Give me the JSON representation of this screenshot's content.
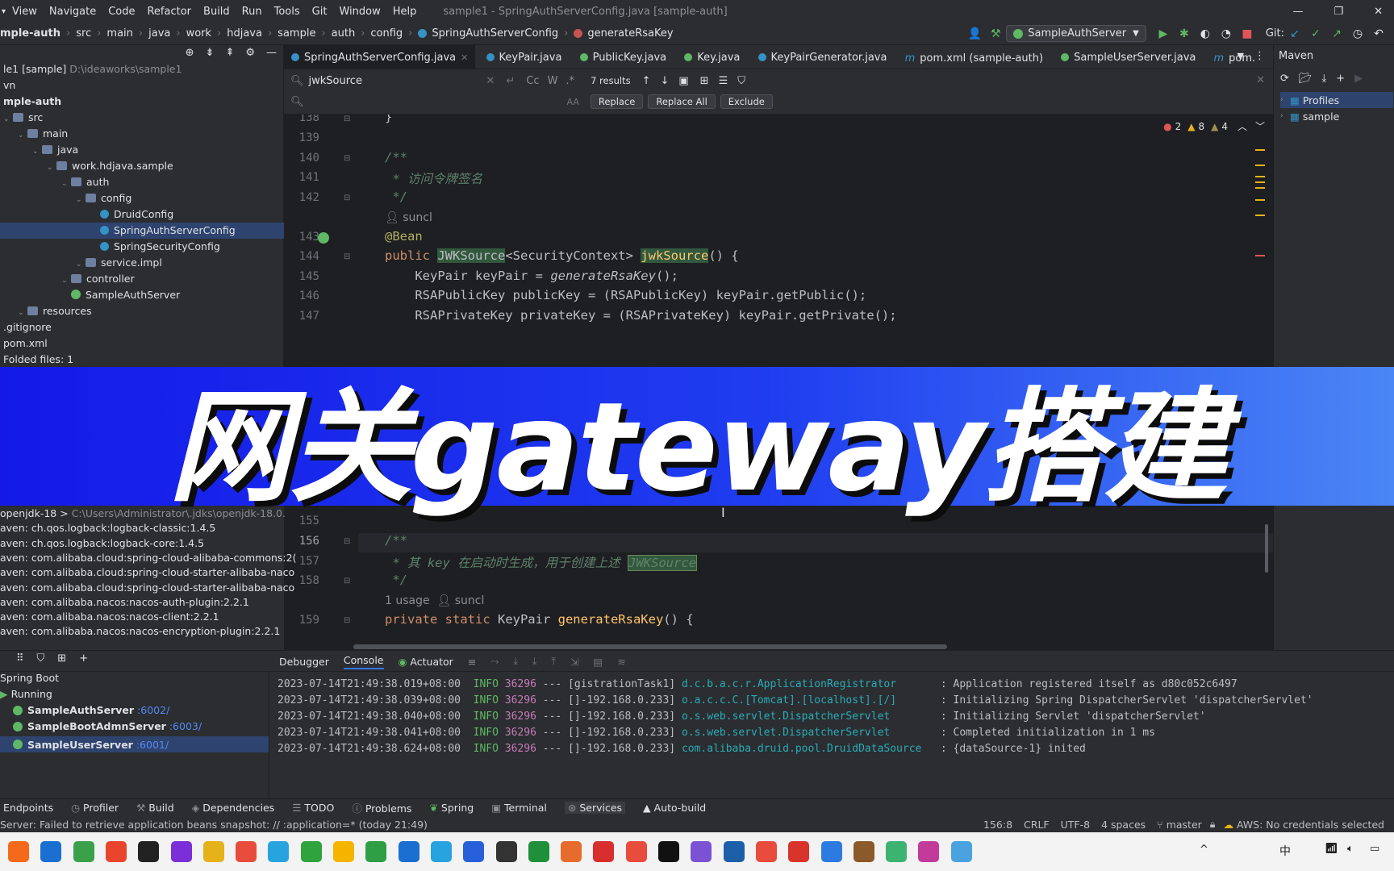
{
  "menu": {
    "items": [
      "View",
      "Navigate",
      "Code",
      "Refactor",
      "Build",
      "Run",
      "Tools",
      "Git",
      "Window",
      "Help"
    ],
    "window_title": "sample1 - SpringAuthServerConfig.java [sample-auth]"
  },
  "breadcrumb": [
    "mple-auth",
    "src",
    "main",
    "java",
    "work",
    "hdjava",
    "sample",
    "auth",
    "config",
    "SpringAuthServerConfig",
    "generateRsaKey"
  ],
  "toolbar": {
    "run_config": "SampleAuthServer",
    "git_label": "Git:"
  },
  "project_tree": [
    {
      "label": "le1 [sample]",
      "extra": "D:\\ideaworks\\sample1",
      "indent": 0,
      "icon": "module"
    },
    {
      "label": "vn",
      "indent": 0,
      "icon": "none"
    },
    {
      "label": "mple-auth",
      "indent": 0,
      "icon": "none",
      "bold": true
    },
    {
      "label": "src",
      "indent": 0,
      "icon": "folder"
    },
    {
      "label": "main",
      "indent": 1,
      "icon": "folder"
    },
    {
      "label": "java",
      "indent": 2,
      "icon": "folder"
    },
    {
      "label": "work.hdjava.sample",
      "indent": 3,
      "icon": "folder"
    },
    {
      "label": "auth",
      "indent": 4,
      "icon": "folder"
    },
    {
      "label": "config",
      "indent": 5,
      "icon": "folder"
    },
    {
      "label": "DruidConfig",
      "indent": 6,
      "icon": "class"
    },
    {
      "label": "SpringAuthServerConfig",
      "indent": 6,
      "icon": "class",
      "selected": true
    },
    {
      "label": "SpringSecurityConfig",
      "indent": 6,
      "icon": "class"
    },
    {
      "label": "service.impl",
      "indent": 5,
      "icon": "folder"
    },
    {
      "label": "controller",
      "indent": 4,
      "icon": "folder"
    },
    {
      "label": "SampleAuthServer",
      "indent": 4,
      "icon": "springboot"
    },
    {
      "label": "resources",
      "indent": 1,
      "icon": "folder"
    },
    {
      "label": ".gitignore",
      "indent": 0,
      "icon": "none"
    },
    {
      "label": "pom.xml",
      "indent": 0,
      "icon": "none"
    },
    {
      "label": "Folded files: 1",
      "indent": 0,
      "icon": "none"
    }
  ],
  "tabs": [
    "SpringAuthServerConfig.java",
    "KeyPair.java",
    "PublicKey.java",
    "Key.java",
    "KeyPairGenerator.java",
    "pom.xml (sample-auth)",
    "SampleUserServer.java",
    "pom."
  ],
  "find": {
    "query": "jwkSource",
    "results": "7 results",
    "replace_label": "Replace",
    "replace_all_label": "Replace All",
    "exclude_label": "Exclude"
  },
  "inspections": {
    "errors": "2",
    "warnings": "8",
    "weak": "4"
  },
  "code": {
    "lines_top": [
      {
        "n": "138",
        "t": "}"
      },
      {
        "n": "139",
        "t": ""
      },
      {
        "n": "140",
        "t": "/**"
      },
      {
        "n": "141",
        "t": " * 访问令牌签名"
      },
      {
        "n": "142",
        "t": " */"
      },
      {
        "n": "143",
        "t": "@Bean"
      },
      {
        "n": "144",
        "t": "public JWKSource<SecurityContext> jwkSource() {"
      },
      {
        "n": "145",
        "t": "KeyPair keyPair = generateRsaKey();"
      },
      {
        "n": "146",
        "t": "RSAPublicKey publicKey = (RSAPublicKey) keyPair.getPublic();"
      },
      {
        "n": "147",
        "t": "RSAPrivateKey privateKey = (RSAPrivateKey) keyPair.getPrivate();"
      }
    ],
    "author_hint": "suncl",
    "usage_hint": "1 usage",
    "lines_bottom": [
      {
        "n": "155",
        "t": ""
      },
      {
        "n": "156",
        "t": "/**"
      },
      {
        "n": "157",
        "t": " * 其 key 在启动时生成，用于创建上述 JWKSource"
      },
      {
        "n": "158",
        "t": " */"
      },
      {
        "n": "159",
        "t": "private static KeyPair generateRsaKey() {"
      }
    ]
  },
  "maven": {
    "title": "Maven",
    "items": [
      "Profiles",
      "sample"
    ]
  },
  "dependencies": [
    {
      "label": "openjdk-18 >",
      "extra": "C:\\Users\\Administrator\\.jdks\\openjdk-18.0."
    },
    {
      "label": "aven: ch.qos.logback:logback-classic:1.4.5"
    },
    {
      "label": "aven: ch.qos.logback:logback-core:1.4.5"
    },
    {
      "label": "aven: com.alibaba.cloud:spring-cloud-alibaba-commons:2("
    },
    {
      "label": "aven: com.alibaba.cloud:spring-cloud-starter-alibaba-naco"
    },
    {
      "label": "aven: com.alibaba.cloud:spring-cloud-starter-alibaba-naco"
    },
    {
      "label": "aven: com.alibaba.nacos:nacos-auth-plugin:2.2.1"
    },
    {
      "label": "aven: com.alibaba.nacos:nacos-client:2.2.1"
    },
    {
      "label": "aven: com.alibaba.nacos:nacos-encryption-plugin:2.2.1"
    }
  ],
  "services": {
    "root": "Spring Boot",
    "running": "Running",
    "servers": [
      {
        "name": "SampleAuthServer",
        "port": ":6002/"
      },
      {
        "name": "SampleBootAdmnServer",
        "port": ":6003/"
      },
      {
        "name": "SampleUserServer",
        "port": ":6001/",
        "selected": true
      }
    ]
  },
  "console_tabs": [
    "Debugger",
    "Console",
    "Actuator"
  ],
  "console_lines": [
    {
      "ts": "2023-07-14T21:49:38.019+08:00",
      "lvl": "INFO",
      "pid": "36296",
      "thr": "--- [gistrationTask1]",
      "logger": "d.c.b.a.c.r.ApplicationRegistrator      ",
      "msg": ": Application registered itself as d80c052c6497"
    },
    {
      "ts": "2023-07-14T21:49:38.039+08:00",
      "lvl": "INFO",
      "pid": "36296",
      "thr": "--- []-192.168.0.233]",
      "logger": "o.a.c.c.C.[Tomcat].[localhost].[/]      ",
      "msg": ": Initializing Spring DispatcherServlet 'dispatcherServlet'"
    },
    {
      "ts": "2023-07-14T21:49:38.040+08:00",
      "lvl": "INFO",
      "pid": "36296",
      "thr": "--- []-192.168.0.233]",
      "logger": "o.s.web.servlet.DispatcherServlet       ",
      "msg": ": Initializing Servlet 'dispatcherServlet'"
    },
    {
      "ts": "2023-07-14T21:49:38.041+08:00",
      "lvl": "INFO",
      "pid": "36296",
      "thr": "--- []-192.168.0.233]",
      "logger": "o.s.web.servlet.DispatcherServlet       ",
      "msg": ": Completed initialization in 1 ms"
    },
    {
      "ts": "2023-07-14T21:49:38.624+08:00",
      "lvl": "INFO",
      "pid": "36296",
      "thr": "--- []-192.168.0.233]",
      "logger": "com.alibaba.druid.pool.DruidDataSource  ",
      "msg": ": {dataSource-1} inited"
    }
  ],
  "tool_windows": [
    "Endpoints",
    "Profiler",
    "Build",
    "Dependencies",
    "TODO",
    "Problems",
    "Spring",
    "Terminal",
    "Services",
    "Auto-build"
  ],
  "status": {
    "message": "Server: Failed to retrieve application beans snapshot: // :application=* (today 21:49)",
    "position": "156:8",
    "line_sep": "CRLF",
    "encoding": "UTF-8",
    "indent": "4 spaces",
    "branch": "master",
    "aws": "AWS: No credentials selected"
  },
  "banner": {
    "text": "网关gateway搭建"
  },
  "taskbar": {
    "icons": [
      "#f56a1a",
      "#1b6fd1",
      "#3aa14a",
      "#e8452c",
      "#222222",
      "#7a2fd8",
      "#e5b21a",
      "#e84c3d",
      "#27a4e0",
      "#2fa33e",
      "#f5b400",
      "#2f9e44",
      "#1b6fd1",
      "#27a4e0",
      "#2860d9",
      "#333333",
      "#1f8f3a",
      "#e66b2c",
      "#d92e2e",
      "#e84c3d",
      "#111111",
      "#7b52d3",
      "#1d5fa8",
      "#e84c3d",
      "#d9342b",
      "#2d7be0",
      "#8a5a2b",
      "#3cb371",
      "#c23b9a",
      "#4aa3df"
    ],
    "tray": [
      "^",
      "中"
    ]
  }
}
